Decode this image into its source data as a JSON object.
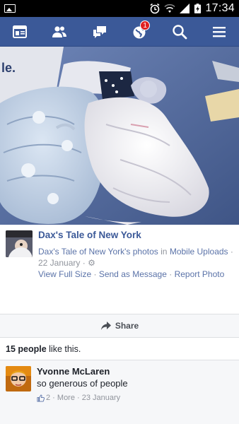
{
  "status_bar": {
    "time": "17:34",
    "icons": [
      "image-icon",
      "alarm-icon",
      "wifi-icon",
      "signal-icon",
      "battery-charging-icon"
    ]
  },
  "navbar": {
    "items": [
      {
        "name": "news-feed-icon"
      },
      {
        "name": "friends-icon"
      },
      {
        "name": "messages-icon"
      },
      {
        "name": "notifications-globe-icon",
        "badge": "1"
      },
      {
        "name": "search-icon"
      },
      {
        "name": "menu-icon"
      }
    ],
    "bg_color": "#3b5998"
  },
  "post": {
    "page_name": "Dax's Tale of New York",
    "album_source": "Dax's Tale of New York's photos",
    "album_in": "in",
    "album_name": "Mobile Uploads",
    "date": "22 January",
    "dot": "·",
    "actions": [
      "View Full Size",
      "Send as Message",
      "Report Photo"
    ]
  },
  "share": {
    "label": "Share"
  },
  "likes": {
    "count": "15 people",
    "suffix": "like this."
  },
  "comments": [
    {
      "author": "Yvonne McLaren",
      "text": "so generous of people",
      "likes": "2",
      "more": "More",
      "date": "23 January"
    }
  ]
}
